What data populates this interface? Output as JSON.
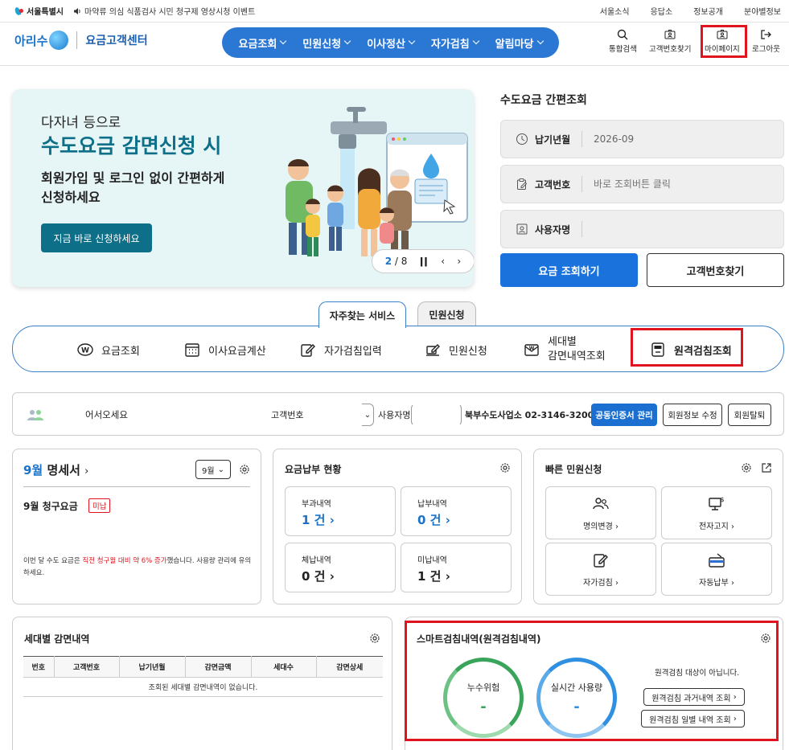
{
  "topbar": {
    "city": "서울특별시",
    "notice": "마약류 의심 식품검사 시민 청구제 영상시청 이벤트",
    "links": [
      "서울소식",
      "응답소",
      "정보공개",
      "분야별정보"
    ]
  },
  "header": {
    "brand": "아리수",
    "center": "요금고객센터",
    "nav": [
      "요금조회",
      "민원신청",
      "이사정산",
      "자가검침",
      "알림마당"
    ],
    "utils": [
      "통합검색",
      "고객번호찾기",
      "마이페이지",
      "로그아웃"
    ]
  },
  "banner": {
    "subtitle": "다자녀 등으로",
    "title": "수도요금 감면신청 시",
    "desc": "회원가입 및 로그인 없이 간편하게 신청하세요",
    "cta": "지금 바로 신청하세요",
    "page_current": "2",
    "page_sep": "/",
    "page_total": "8"
  },
  "quick": {
    "title": "수도요금 간편조회",
    "fields": [
      {
        "label": "납기년월",
        "value": "2026-09"
      },
      {
        "label": "고객번호",
        "placeholder": "바로 조회버튼 클릭"
      },
      {
        "label": "사용자명",
        "value": ""
      }
    ],
    "search_btn": "요금 조회하기",
    "find_btn": "고객번호찾기"
  },
  "services": {
    "tabs": [
      "자주찾는 서비스",
      "민원신청"
    ],
    "items": [
      "요금조회",
      "이사요금계산",
      "자가검침입력",
      "민원신청",
      "세대별",
      "감면내역조회",
      "원격검침조회"
    ]
  },
  "userbar": {
    "welcome": "어서오세요",
    "cust_label": "고객번호",
    "user_label": "사용자명",
    "office": "북부수도사업소  02-3146-3200",
    "btn_cert": "공동인증서 관리",
    "btn_edit": "회원정보 수정",
    "btn_leave": "회원탈퇴"
  },
  "bill": {
    "month": "9월",
    "title": "명세서",
    "select": "9월",
    "charge_label": "9월 청구요금",
    "badge": "미납",
    "note_a": "이번 달 수도 요금은 ",
    "note_b": "직전 청구월 대비 약 6% 증가",
    "note_c": "했습니다. 사용량 관리에 유의하세요."
  },
  "payment": {
    "title": "요금납부 현황",
    "stats": [
      {
        "label": "부과내역",
        "value": "1 건"
      },
      {
        "label": "납부내역",
        "value": "0 건"
      },
      {
        "label": "체납내역",
        "value": "0 건"
      },
      {
        "label": "미납내역",
        "value": "1 건"
      }
    ]
  },
  "quickcivil": {
    "title": "빠른 민원신청",
    "items": [
      "명의변경",
      "전자고지",
      "자가검침",
      "자동납부"
    ]
  },
  "reduction": {
    "title": "세대별 감면내역",
    "columns": [
      "번호",
      "고객번호",
      "납기년월",
      "감면금액",
      "세대수",
      "감면상세"
    ],
    "empty": "조회된 세대별 감면내역이 없습니다."
  },
  "smart": {
    "title": "스마트검침내역(원격검침내역)",
    "leak_label": "누수위험",
    "leak_value": "-",
    "usage_label": "실시간 사용량",
    "usage_value": "-",
    "notice": "원격검침 대상이 아닙니다.",
    "btn_history": "원격검침 과거내역 조회",
    "btn_daily": "원격검침 일별 내역 조회"
  },
  "colors": {
    "primary": "#1a73dc",
    "teal": "#0d6f88",
    "highlight": "#e0141e",
    "leak_ring": "#3aa55a",
    "usage_ring": "#2f8fe0"
  }
}
